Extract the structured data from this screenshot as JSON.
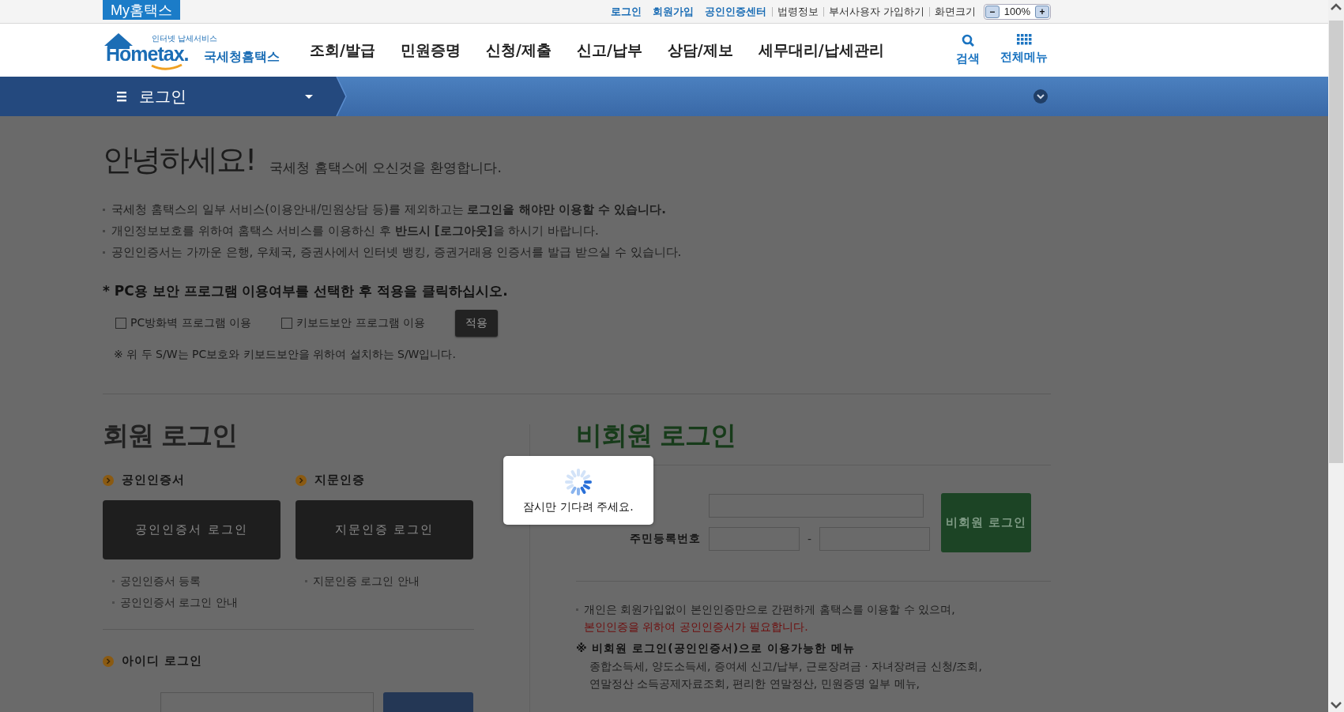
{
  "top_bar": {
    "brand_tab": "My홈택스",
    "links": [
      {
        "label": "로그인",
        "kind": "primary"
      },
      {
        "label": "회원가입",
        "kind": "primary"
      },
      {
        "label": "공인인증센터",
        "kind": "primary"
      },
      {
        "label": "법령정보",
        "kind": "secondary"
      },
      {
        "label": "부서사용자 가입하기",
        "kind": "secondary"
      }
    ],
    "zoom": {
      "label": "화면크기",
      "minus": "−",
      "value": "100%",
      "plus": "+"
    }
  },
  "header": {
    "logo": {
      "tagline": "인터넷 납세서비스",
      "wordmark": "Hometax.",
      "name": "국세청홈택스"
    },
    "nav": [
      "조회/발급",
      "민원증명",
      "신청/제출",
      "신고/납부",
      "상담/제보",
      "세무대리/납세관리"
    ],
    "tools": [
      {
        "label": "검색",
        "kind": "search"
      },
      {
        "label": "전체메뉴",
        "kind": "grid"
      }
    ]
  },
  "location_bar": {
    "menu_label": "로그인"
  },
  "welcome": {
    "title": "안녕하세요!",
    "subtitle": "국세청 홈택스에 오신것을 환영합니다.",
    "notices": [
      "국세청 홈택스의 일부 서비스(이용안내/민원상담 등)를 제외하고는 **로그인을 해야만 이용할 수 있습니다.**",
      "개인정보보호를 위하여 홈택스 서비스를 이용하신 후 **반드시 [로그아웃]**을 하시기 바랍니다.",
      "공인인증서는 가까운 은행, 우체국, 증권사에서 인터넷 뱅킹, 증권거래용 인증서를 발급 받으실 수 있습니다."
    ]
  },
  "security": {
    "instruction": "* PC용 보안 프로그램 이용여부를 선택한 후 적용을 클릭하십시오.",
    "options": [
      {
        "label": "PC방화벽 프로그램 이용",
        "checked": false
      },
      {
        "label": "키보드보안 프로그램 이용",
        "checked": false
      }
    ],
    "apply_button": "적용",
    "note": "※ 위 두 S/W는 PC보호와 키보드보안을 위하여 설치하는 S/W입니다."
  },
  "member_login": {
    "title": "회원 로그인",
    "methods": [
      {
        "label": "공인인증서",
        "button": "공인인증서 로그인",
        "links": [
          "공인인증서 등록",
          "공인인증서 로그인 안내"
        ]
      },
      {
        "label": "지문인증",
        "button": "지문인증 로그인",
        "links": [
          "지문인증 로그인 안내"
        ]
      }
    ],
    "id_login": {
      "label": "아이디 로그인"
    }
  },
  "guest_login": {
    "title": "비회원 로그인",
    "rrn_label": "주민등록번호",
    "rrn_separator": "-",
    "button": "비회원 로그인",
    "notice": "개인은 회원가입없이 본인인증만으로 간편하게 홈택스를 이용할 수 있으며,",
    "notice_warning": "본인인증을 위하여 공인인증서가 필요합니다.",
    "menu_title": "※ 비회원 로그인(공인인증서)으로 이용가능한 메뉴",
    "menu_lines": [
      "종합소득세, 양도소득세, 증여세 신고/납부, 근로장려금 · 자녀장려금 신청/조회,",
      "연말정산 소득공제자료조회, 편리한 연말정산, 민원증명 일부 메뉴,"
    ]
  },
  "loading_dialog": {
    "message": "잠시만 기다려 주세요."
  }
}
